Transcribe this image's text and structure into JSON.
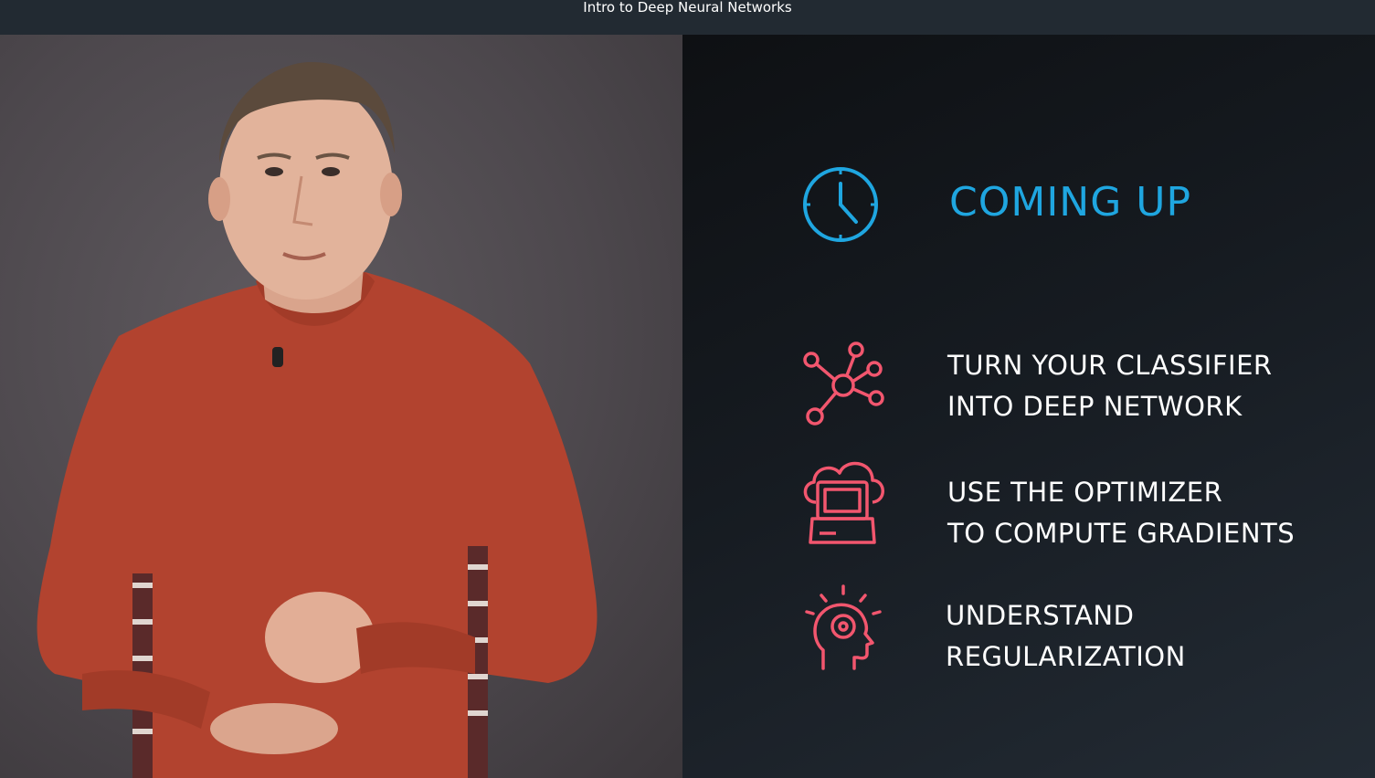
{
  "window": {
    "title": "Intro to Deep Neural Networks"
  },
  "slide": {
    "heading": "COMING UP",
    "heading_icon": "clock-icon",
    "accent_color": "#1fa6e0",
    "item_icon_color": "#f2566e",
    "items": [
      {
        "icon": "network-icon",
        "line1": "TURN YOUR CLASSIFIER",
        "line2": "INTO DEEP NETWORK"
      },
      {
        "icon": "cloud-laptop-icon",
        "line1": "USE THE OPTIMIZER",
        "line2": "TO COMPUTE GRADIENTS"
      },
      {
        "icon": "head-idea-icon",
        "line1": "UNDERSTAND",
        "line2": "REGULARIZATION"
      }
    ]
  },
  "presenter": {
    "sweater_color": "#b2432f"
  }
}
